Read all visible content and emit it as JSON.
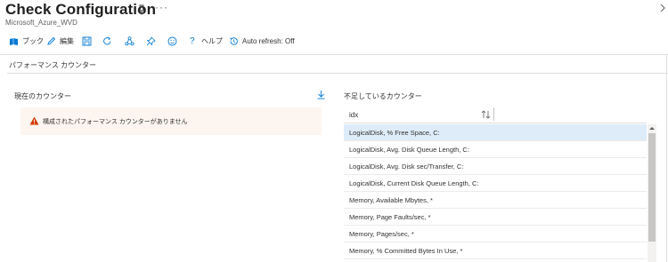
{
  "header": {
    "title": "Check Configuration",
    "subtitle": "Microsoft_Azure_WVD"
  },
  "toolbar": {
    "book_label": "ブック",
    "edit_label": "編集",
    "help_label": "ヘルプ",
    "auto_refresh_label": "Auto refresh: Off"
  },
  "section": {
    "title": "パフォーマンス カウンター"
  },
  "left_panel": {
    "title": "現在のカウンター",
    "warning": "構成されたパフォーマンス カウンターがありません"
  },
  "right_panel": {
    "title": "不足しているカウンター",
    "column_header": "idx",
    "rows": [
      "LogicalDisk, % Free Space, C:",
      "LogicalDisk, Avg. Disk Queue Length, C:",
      "LogicalDisk, Avg. Disk sec/Transfer, C:",
      "LogicalDisk, Current Disk Queue Length, C:",
      "Memory, Available Mbytes, *",
      "Memory, Page Faults/sec, *",
      "Memory, Pages/sec, *",
      "Memory, % Committed Bytes In Use, *"
    ],
    "selected_index": 0
  },
  "colors": {
    "accent": "#0078d4",
    "selected_row": "#deecf9",
    "warning_bg": "#fdf6f0",
    "warning_icon": "#d83b01"
  }
}
